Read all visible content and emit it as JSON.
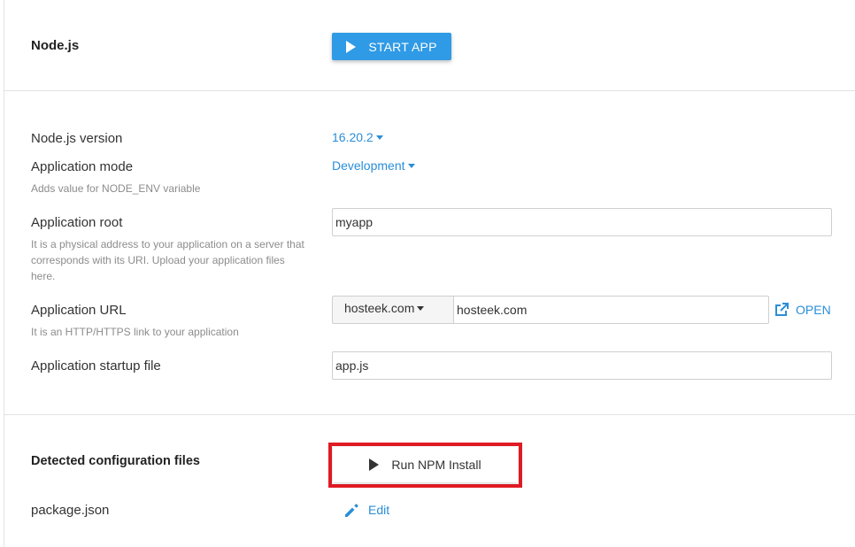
{
  "header": {
    "title": "Node.js",
    "start_button_label": "START APP"
  },
  "settings": {
    "version_label": "Node.js version",
    "version_value": "16.20.2",
    "mode_label": "Application mode",
    "mode_value": "Development",
    "mode_hint": "Adds value for NODE_ENV variable",
    "root_label": "Application root",
    "root_value": "myapp",
    "root_hint": "It is a physical address to your application on a server that corresponds with its URI. Upload your application files here.",
    "url_label": "Application URL",
    "url_domain": "hosteek.com",
    "url_value": "hosteek.com",
    "url_open_label": "OPEN",
    "url_hint": "It is an HTTP/HTTPS link to your application",
    "startup_label": "Application startup file",
    "startup_value": "app.js"
  },
  "config": {
    "title": "Detected configuration files",
    "npm_button_label": "Run NPM Install",
    "file_name": "package.json",
    "edit_label": "Edit"
  },
  "colors": {
    "accent": "#2f9ae5",
    "link": "#2a8ed8",
    "highlight": "#e01b24"
  },
  "icons": {
    "start": "play-icon",
    "open": "external-link-icon",
    "edit": "pencil-icon"
  }
}
